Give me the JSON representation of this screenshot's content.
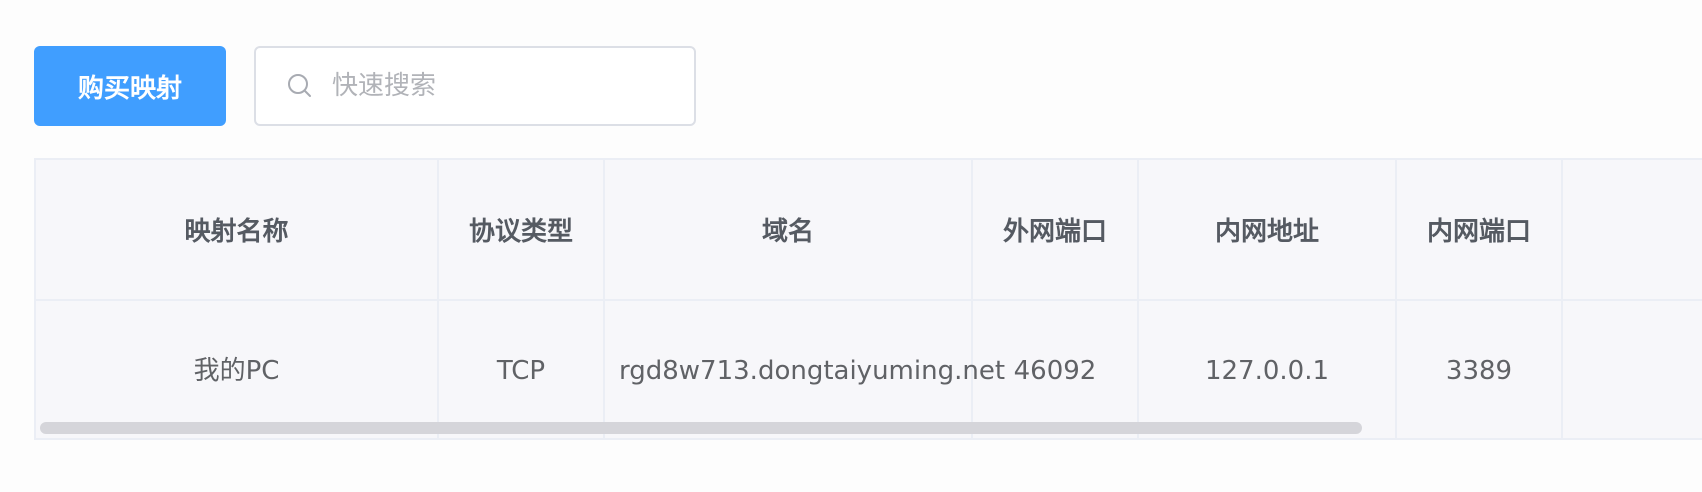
{
  "toolbar": {
    "buy_label": "购买映射",
    "search_placeholder": "快速搜索",
    "search_value": ""
  },
  "table": {
    "columns": [
      "映射名称",
      "协议类型",
      "域名",
      "外网端口",
      "内网地址",
      "内网端口"
    ],
    "rows": [
      {
        "name": "我的PC",
        "protocol": "TCP",
        "domain": "rgd8w713.dongtaiyuming.net",
        "external_port": "46092",
        "internal_address": "127.0.0.1",
        "internal_port": "3389"
      }
    ]
  },
  "colors": {
    "primary": "#409eff",
    "table_bg": "#f7f7fa",
    "border": "#ebeef5"
  },
  "icons": {
    "search": "search-icon"
  }
}
